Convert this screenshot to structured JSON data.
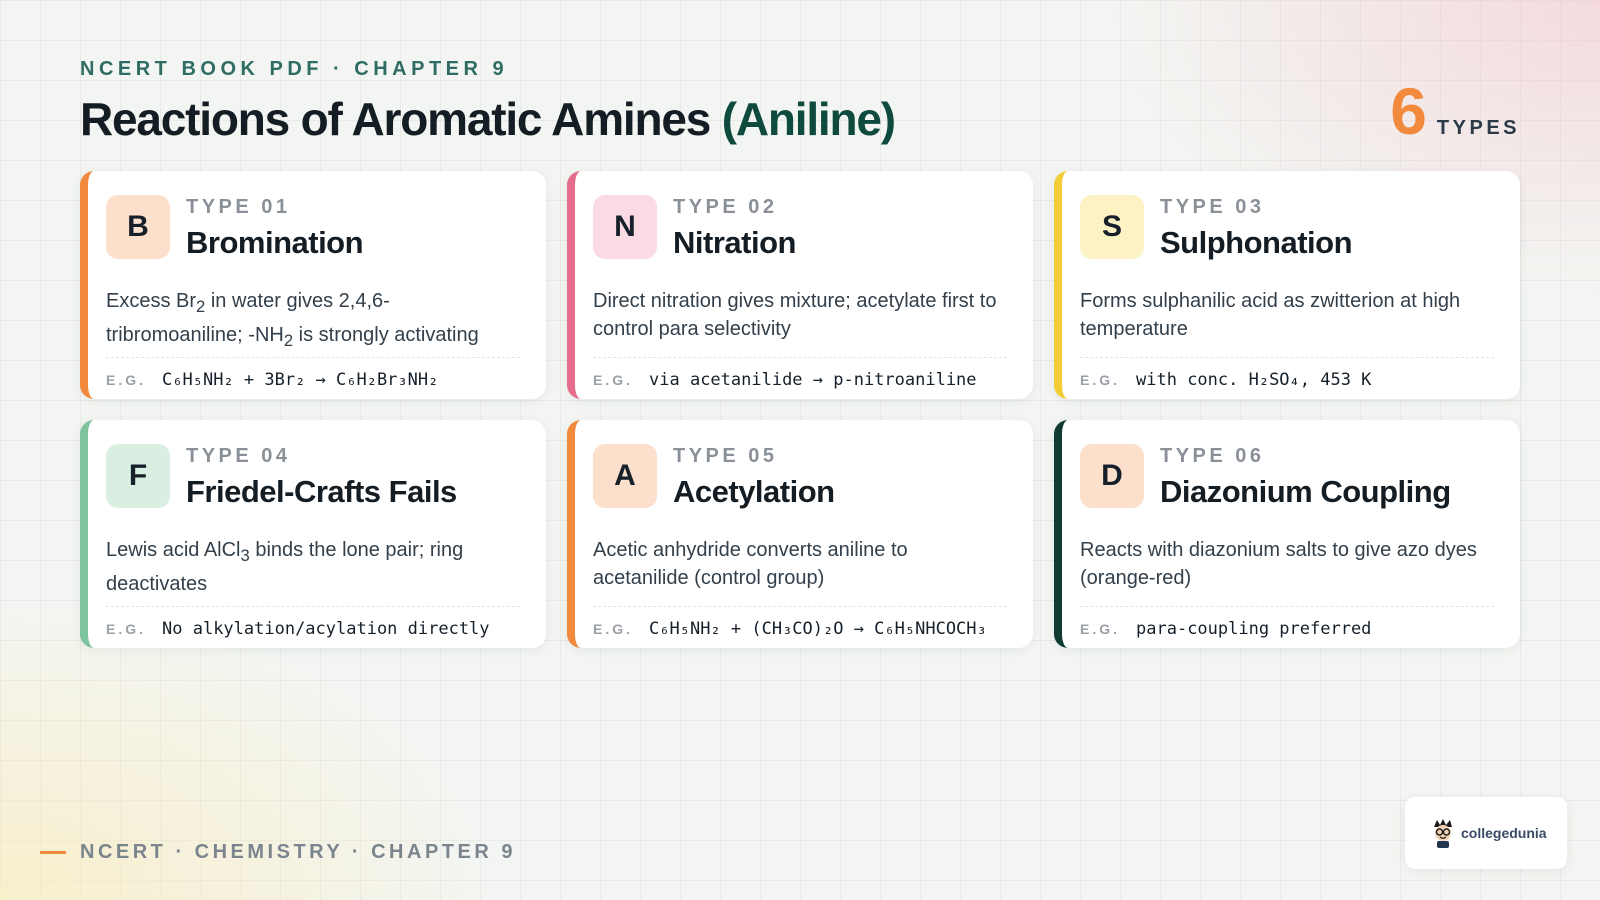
{
  "header": {
    "eyebrow": "NCERT BOOK PDF · CHAPTER 9",
    "title_main": "Reactions of Aromatic Amines ",
    "title_accent": "(Aniline)",
    "count_number": "6",
    "count_label": "TYPES"
  },
  "cards": [
    {
      "accent": "#f28a3d",
      "tint": "#fde0cc",
      "letter": "B",
      "type": "TYPE 01",
      "title": "Bromination",
      "desc_html": "Excess Br<sub>2</sub> in water gives 2,4,6-tribromoaniline; -NH<sub>2</sub> is strongly activating",
      "eg": "E.G.",
      "formula": "C₆H₅NH₂ + 3Br₂ → C₆H₂Br₃NH₂"
    },
    {
      "accent": "#e66d8a",
      "tint": "#fbdbe3",
      "letter": "N",
      "type": "TYPE 02",
      "title": "Nitration",
      "desc_html": "Direct nitration gives mixture; acetylate first to control para selectivity",
      "eg": "E.G.",
      "formula": "via acetanilide → p-nitroaniline"
    },
    {
      "accent": "#f4cc35",
      "tint": "#fdf2c4",
      "letter": "S",
      "type": "TYPE 03",
      "title": "Sulphonation",
      "desc_html": "Forms sulphanilic acid as zwitterion at high temperature",
      "eg": "E.G.",
      "formula": "with conc. H₂SO₄, 453 K"
    },
    {
      "accent": "#7cc39e",
      "tint": "#d8efe2",
      "letter": "F",
      "type": "TYPE 04",
      "title": "Friedel-Crafts Fails",
      "desc_html": "Lewis acid AlCl<sub>3</sub> binds the lone pair; ring deactivates",
      "eg": "E.G.",
      "formula": "No alkylation/acylation directly"
    },
    {
      "accent": "#f28a3d",
      "tint": "#fde0cc",
      "letter": "A",
      "type": "TYPE 05",
      "title": "Acetylation",
      "desc_html": "Acetic anhydride converts aniline to acetanilide (control group)",
      "eg": "E.G.",
      "formula": "C₆H₅NH₂ + (CH₃CO)₂O → C₆H₅NHCOCH₃"
    },
    {
      "accent": "#0f3b33",
      "tint": "#fde0cc",
      "letter": "D",
      "type": "TYPE 06",
      "title": "Diazonium Coupling",
      "desc_html": "Reacts with diazonium salts to give azo dyes (orange-red)",
      "eg": "E.G.",
      "formula": "para-coupling preferred"
    }
  ],
  "footer": {
    "text": "NCERT · CHEMISTRY · CHAPTER 9"
  },
  "logo": {
    "text": "collegedunia",
    "icon": "mascot-icon"
  }
}
